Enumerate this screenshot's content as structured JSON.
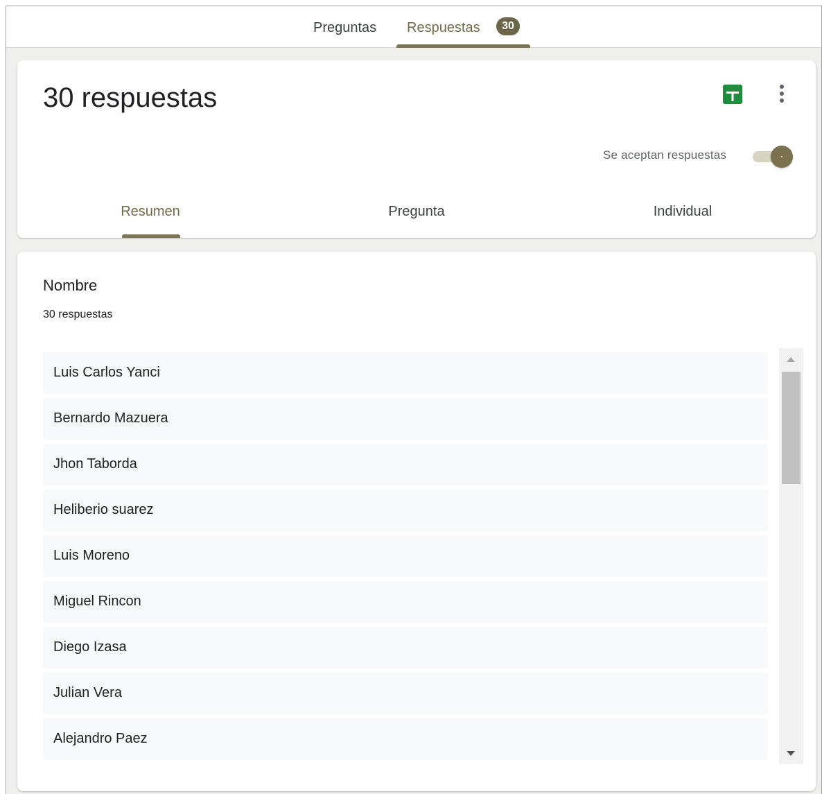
{
  "top_tabs": {
    "questions_label": "Preguntas",
    "responses_label": "Respuestas",
    "responses_count": "30"
  },
  "header": {
    "title": "30 respuestas",
    "accept_label": "Se aceptan respuestas",
    "accepting": true,
    "sheets_icon": "sheets-icon",
    "more_icon": "more-vert-icon",
    "sheets_color": "#1e8e3e",
    "accent_color": "#7a7553"
  },
  "sub_tabs": {
    "summary": "Resumen",
    "question": "Pregunta",
    "individual": "Individual"
  },
  "question": {
    "title": "Nombre",
    "count": "30 respuestas",
    "responses": [
      "Luis Carlos Yanci",
      "Bernardo Mazuera",
      "Jhon Taborda",
      "Heliberio suarez",
      "Luis Moreno",
      "Miguel Rincon",
      "Diego Izasa",
      "Julian Vera",
      "Alejandro Paez"
    ]
  }
}
